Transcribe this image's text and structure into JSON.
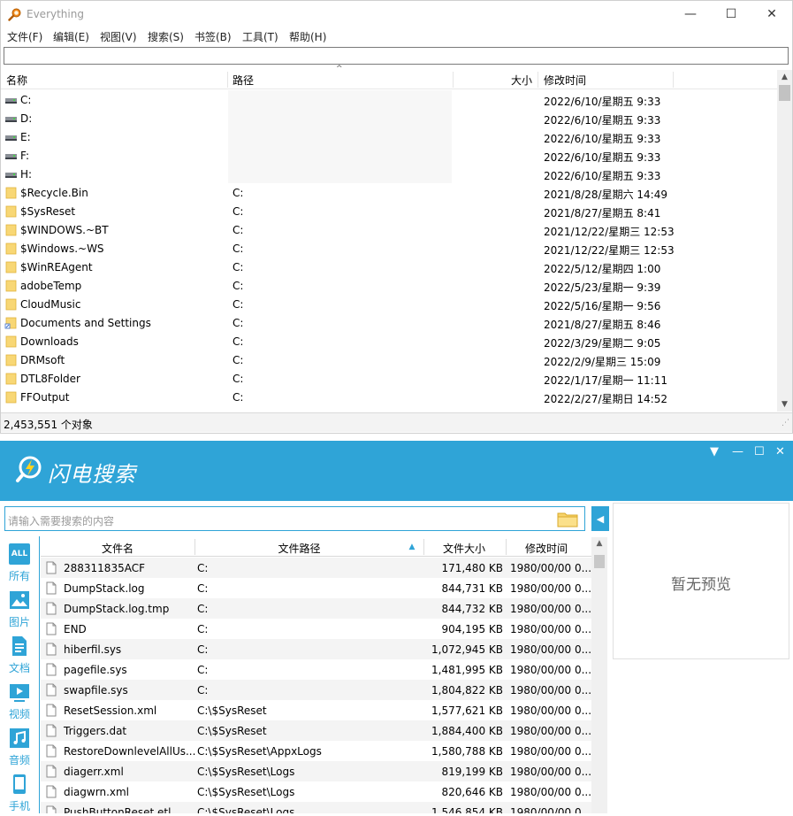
{
  "everything": {
    "title": "Everything",
    "window_buttons": {
      "minimize": "—",
      "maximize": "☐",
      "close": "✕"
    },
    "menu": [
      "文件(F)",
      "编辑(E)",
      "视图(V)",
      "搜索(S)",
      "书签(B)",
      "工具(T)",
      "帮助(H)"
    ],
    "search_value": "",
    "columns": {
      "name": "名称",
      "path": "路径",
      "size": "大小",
      "modified": "修改时间"
    },
    "rows": [
      {
        "icon": "drive",
        "name": "C:",
        "path": "",
        "modified": "2022/6/10/星期五 9:33"
      },
      {
        "icon": "drive",
        "name": "D:",
        "path": "",
        "modified": "2022/6/10/星期五 9:33"
      },
      {
        "icon": "drive",
        "name": "E:",
        "path": "",
        "modified": "2022/6/10/星期五 9:33"
      },
      {
        "icon": "drive",
        "name": "F:",
        "path": "",
        "modified": "2022/6/10/星期五 9:33"
      },
      {
        "icon": "drive",
        "name": "H:",
        "path": "",
        "modified": "2022/6/10/星期五 9:33"
      },
      {
        "icon": "folder",
        "name": "$Recycle.Bin",
        "path": "C:",
        "modified": "2021/8/28/星期六 14:49"
      },
      {
        "icon": "folder",
        "name": "$SysReset",
        "path": "C:",
        "modified": "2021/8/27/星期五 8:41"
      },
      {
        "icon": "folder",
        "name": "$WINDOWS.~BT",
        "path": "C:",
        "modified": "2021/12/22/星期三 12:53"
      },
      {
        "icon": "folder",
        "name": "$Windows.~WS",
        "path": "C:",
        "modified": "2021/12/22/星期三 12:53"
      },
      {
        "icon": "folder",
        "name": "$WinREAgent",
        "path": "C:",
        "modified": "2022/5/12/星期四 1:00"
      },
      {
        "icon": "folder",
        "name": "adobeTemp",
        "path": "C:",
        "modified": "2022/5/23/星期一 9:39"
      },
      {
        "icon": "folder",
        "name": "CloudMusic",
        "path": "C:",
        "modified": "2022/5/16/星期一 9:56"
      },
      {
        "icon": "folder-link",
        "name": "Documents and Settings",
        "path": "C:",
        "modified": "2021/8/27/星期五 8:46"
      },
      {
        "icon": "folder",
        "name": "Downloads",
        "path": "C:",
        "modified": "2022/3/29/星期二 9:05"
      },
      {
        "icon": "folder",
        "name": "DRMsoft",
        "path": "C:",
        "modified": "2022/2/9/星期三 15:09"
      },
      {
        "icon": "folder",
        "name": "DTL8Folder",
        "path": "C:",
        "modified": "2022/1/17/星期一 11:11"
      },
      {
        "icon": "folder",
        "name": "FFOutput",
        "path": "C:",
        "modified": "2022/2/27/星期日 14:52"
      }
    ],
    "status": "2,453,551 个对象"
  },
  "lightning": {
    "brand": "闪电搜索",
    "header_buttons": {
      "menu": "▼",
      "minimize": "—",
      "maximize": "☐",
      "close": "✕"
    },
    "search_placeholder": "请输入需要搜索的内容",
    "preview_text": "暂无预览",
    "categories": [
      {
        "icon": "all-icon",
        "label": "所有",
        "badge": "ALL"
      },
      {
        "icon": "image-icon",
        "label": "图片"
      },
      {
        "icon": "document-icon",
        "label": "文档"
      },
      {
        "icon": "video-icon",
        "label": "视频"
      },
      {
        "icon": "audio-icon",
        "label": "音频"
      },
      {
        "icon": "phone-icon",
        "label": "手机"
      }
    ],
    "columns": {
      "name": "文件名",
      "path": "文件路径",
      "size": "文件大小",
      "modified": "修改时间"
    },
    "rows": [
      {
        "name": "288311835ACF",
        "path": "C:",
        "size": "171,480 KB",
        "modified": "1980/00/00 0..."
      },
      {
        "name": "DumpStack.log",
        "path": "C:",
        "size": "844,731 KB",
        "modified": "1980/00/00 0..."
      },
      {
        "name": "DumpStack.log.tmp",
        "path": "C:",
        "size": "844,732 KB",
        "modified": "1980/00/00 0..."
      },
      {
        "name": "END",
        "path": "C:",
        "size": "904,195 KB",
        "modified": "1980/00/00 0..."
      },
      {
        "name": "hiberfil.sys",
        "path": "C:",
        "size": "1,072,945 KB",
        "modified": "1980/00/00 0..."
      },
      {
        "name": "pagefile.sys",
        "path": "C:",
        "size": "1,481,995 KB",
        "modified": "1980/00/00 0..."
      },
      {
        "name": "swapfile.sys",
        "path": "C:",
        "size": "1,804,822 KB",
        "modified": "1980/00/00 0..."
      },
      {
        "name": "ResetSession.xml",
        "path": "C:\\$SysReset",
        "size": "1,577,621 KB",
        "modified": "1980/00/00 0..."
      },
      {
        "name": "Triggers.dat",
        "path": "C:\\$SysReset",
        "size": "1,884,400 KB",
        "modified": "1980/00/00 0..."
      },
      {
        "name": "RestoreDownlevelAllUs...",
        "path": "C:\\$SysReset\\AppxLogs",
        "size": "1,580,788 KB",
        "modified": "1980/00/00 0..."
      },
      {
        "name": "diagerr.xml",
        "path": "C:\\$SysReset\\Logs",
        "size": "819,199 KB",
        "modified": "1980/00/00 0..."
      },
      {
        "name": "diagwrn.xml",
        "path": "C:\\$SysReset\\Logs",
        "size": "820,646 KB",
        "modified": "1980/00/00 0..."
      },
      {
        "name": "PushButtonReset.etl",
        "path": "C:\\$SysReset\\Logs",
        "size": "1,546,854 KB",
        "modified": "1980/00/00 0..."
      }
    ]
  }
}
